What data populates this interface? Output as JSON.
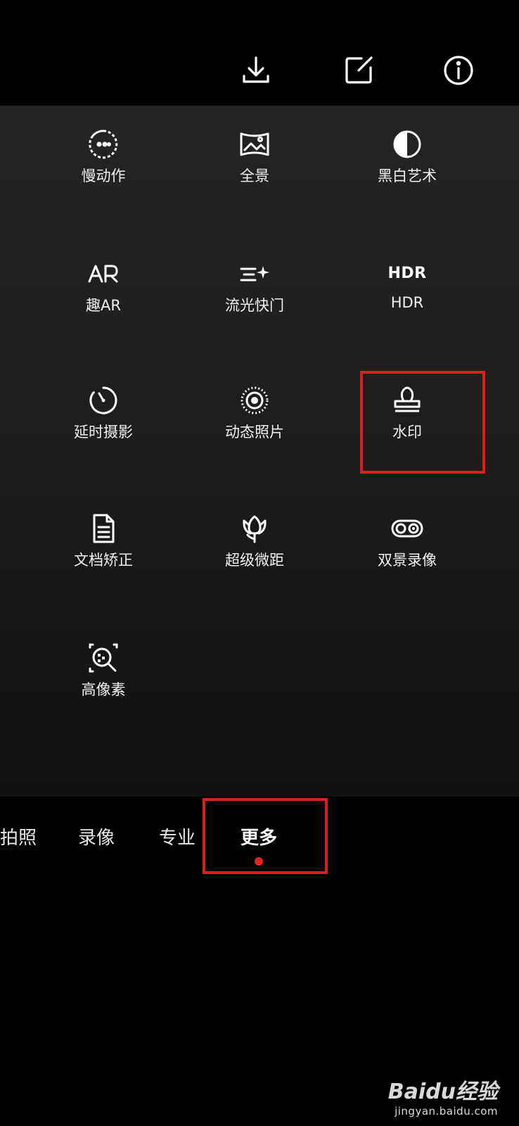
{
  "top_icons": [
    "download-icon",
    "edit-icon",
    "info-icon"
  ],
  "modes": [
    {
      "label": "慢动作",
      "icon": "slow-motion-icon"
    },
    {
      "label": "全景",
      "icon": "panorama-icon"
    },
    {
      "label": "黑白艺术",
      "icon": "bw-art-icon"
    },
    {
      "label": "趣AR",
      "icon": "ar-icon",
      "glyph": "AR"
    },
    {
      "label": "流光快门",
      "icon": "light-trail-icon"
    },
    {
      "label": "HDR",
      "icon": "hdr-icon",
      "glyph": "HDR"
    },
    {
      "label": "延时摄影",
      "icon": "timelapse-icon"
    },
    {
      "label": "动态照片",
      "icon": "live-photo-icon"
    },
    {
      "label": "水印",
      "icon": "watermark-stamp-icon"
    },
    {
      "label": "文档矫正",
      "icon": "document-icon"
    },
    {
      "label": "超级微距",
      "icon": "macro-flower-icon"
    },
    {
      "label": "双景录像",
      "icon": "dual-view-icon"
    },
    {
      "label": "高像素",
      "icon": "high-pixel-icon"
    }
  ],
  "mode_bar": {
    "tabs": [
      "拍照",
      "录像",
      "专业",
      "更多"
    ],
    "active": "更多"
  },
  "watermark": {
    "brand": "Baidu经验",
    "url": "jingyan.baidu.com"
  },
  "colors": {
    "highlight": "#d9201f",
    "active_dot": "#e5261f",
    "background": "#000000"
  }
}
